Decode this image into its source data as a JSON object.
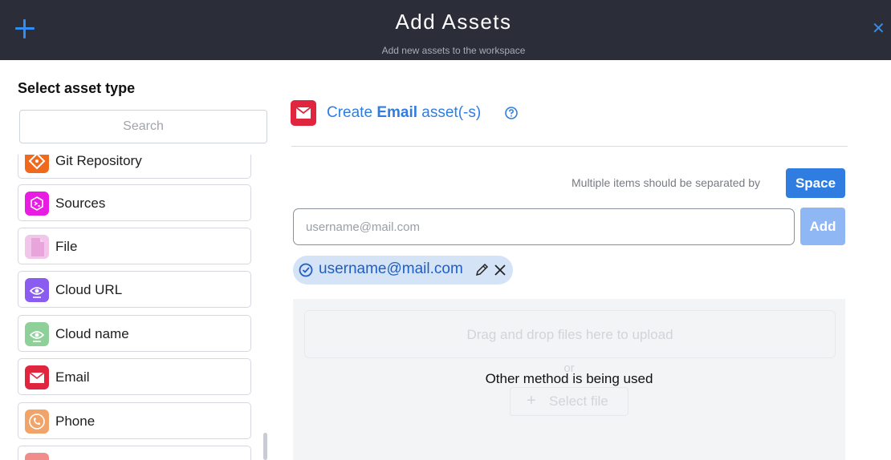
{
  "header": {
    "title": "Add Assets",
    "subtitle": "Add new assets to the workspace",
    "close_glyph": "✕",
    "accent_color": "#2f8df3",
    "background": "#2b2e38"
  },
  "sidebar": {
    "heading": "Select asset type",
    "search_placeholder": "Search",
    "items": [
      {
        "label": "Git Repository",
        "icon": "git-icon",
        "color": "#f06a1d"
      },
      {
        "label": "Sources",
        "icon": "terminal-icon",
        "color": "#e91ce4"
      },
      {
        "label": "File",
        "icon": "file-icon",
        "color": "#e8a5dc"
      },
      {
        "label": "Cloud URL",
        "icon": "cloud-eye-icon",
        "color": "#8b5cf0"
      },
      {
        "label": "Cloud name",
        "icon": "cloud-eye-icon",
        "color": "#8fcf9a"
      },
      {
        "label": "Email",
        "icon": "envelope-icon",
        "color": "#e0253f"
      },
      {
        "label": "Phone",
        "icon": "phone-icon",
        "color": "#f0a46a"
      },
      {
        "label": "",
        "icon": "partial-icon",
        "color": "#f08c8c"
      }
    ]
  },
  "main": {
    "create_prefix": "Create",
    "create_type": "Email",
    "create_suffix": "asset(-s)",
    "separator_hint": "Multiple items should be separated by",
    "space_button": "Space",
    "input_placeholder": "username@mail.com",
    "add_button": "Add",
    "chip_value": "username@mail.com",
    "upload": {
      "dropzone_text": "Drag and drop files here to upload",
      "or_text": "or",
      "select_file": "Select file",
      "overlay_message": "Other method is being used"
    },
    "primary_color": "#2f7de1"
  }
}
